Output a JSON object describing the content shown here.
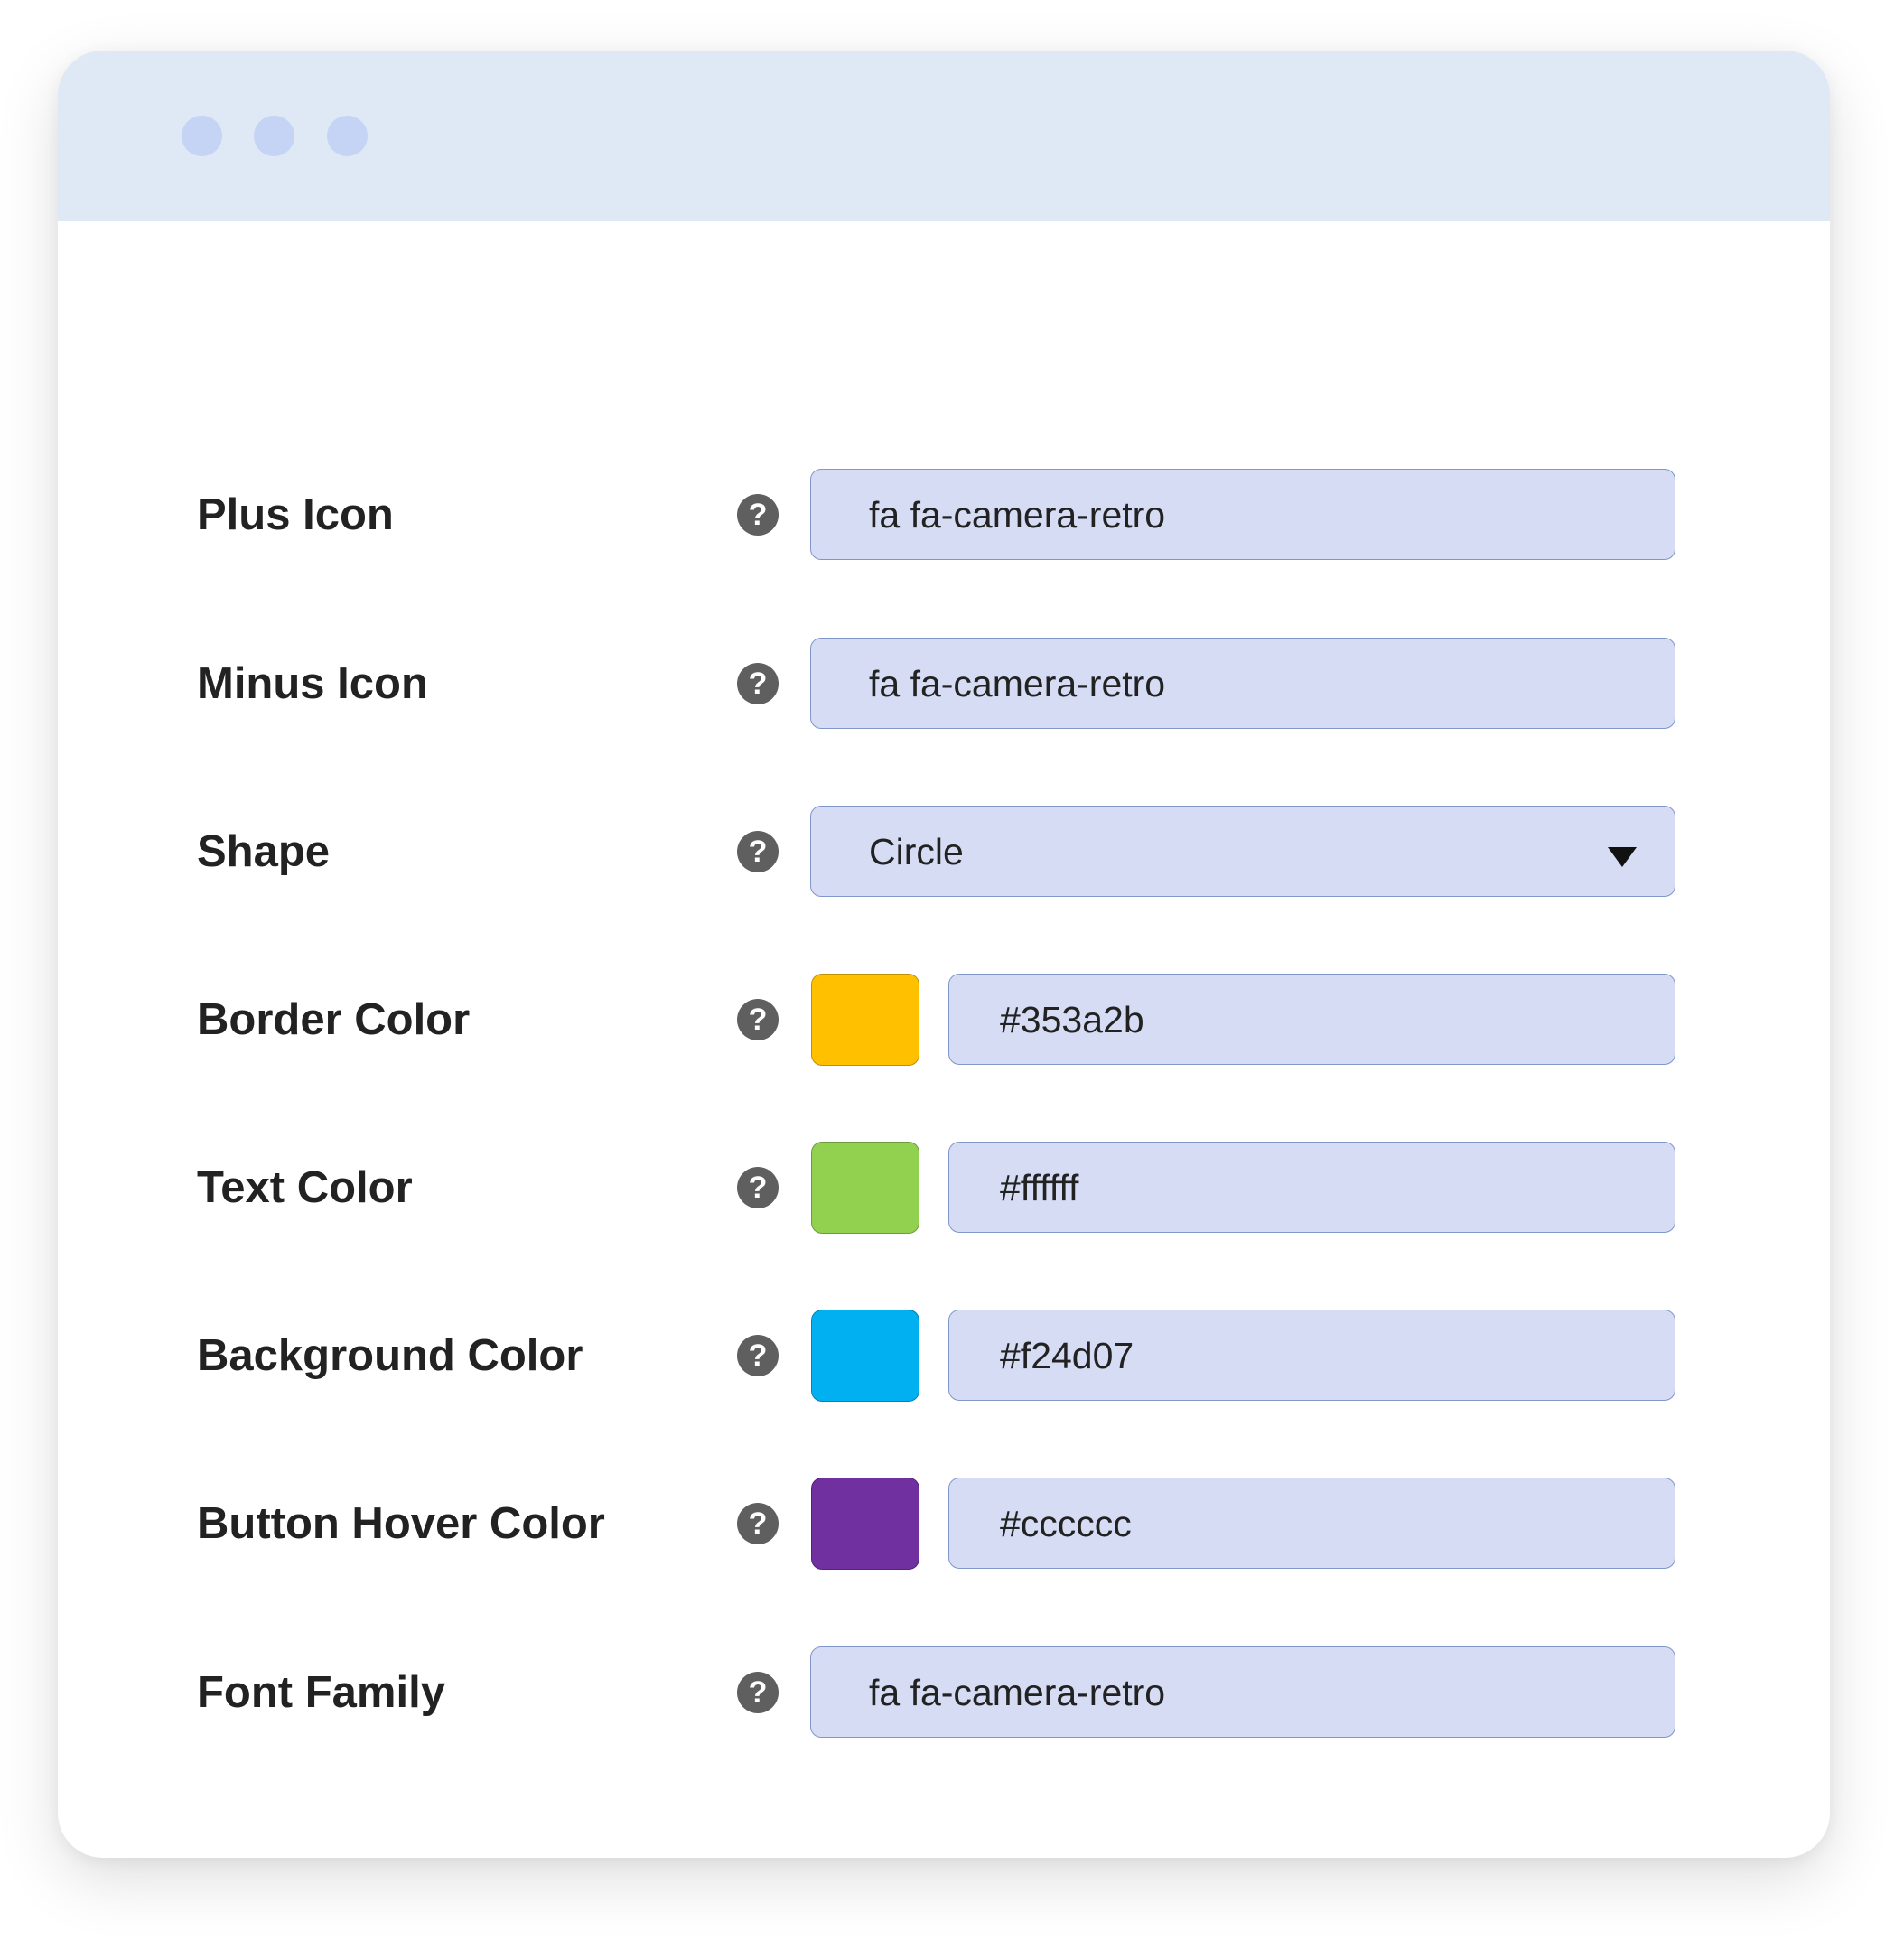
{
  "window": {
    "controls": [
      "close-dot",
      "minimize-dot",
      "maximize-dot"
    ]
  },
  "settings": [
    {
      "label": "Plus Icon",
      "type": "text",
      "value": "fa fa-camera-retro"
    },
    {
      "label": "Minus Icon",
      "type": "text",
      "value": "fa fa-camera-retro"
    },
    {
      "label": "Shape",
      "type": "select",
      "value": "Circle"
    },
    {
      "label": "Border Color",
      "type": "color",
      "value": "#353a2b",
      "swatch": "#ffc000"
    },
    {
      "label": "Text Color",
      "type": "color",
      "value": "#ffffff",
      "swatch": "#92d050"
    },
    {
      "label": "Background Color",
      "type": "color",
      "value": "#f24d07",
      "swatch": "#00b0f0"
    },
    {
      "label": "Button Hover Color",
      "type": "color",
      "value": "#cccccc",
      "swatch": "#7030a0"
    },
    {
      "label": "Font Family",
      "type": "text",
      "value": "fa fa-camera-retro"
    }
  ],
  "help_icon_glyph": "?",
  "colors": {
    "titlebar": "#dfe8f5",
    "window_dot": "#c5d4f4",
    "field_background": "#d5dcf4",
    "field_border": "#7f97c9",
    "help_icon": "#5f5f5f",
    "label_text": "#222222"
  }
}
